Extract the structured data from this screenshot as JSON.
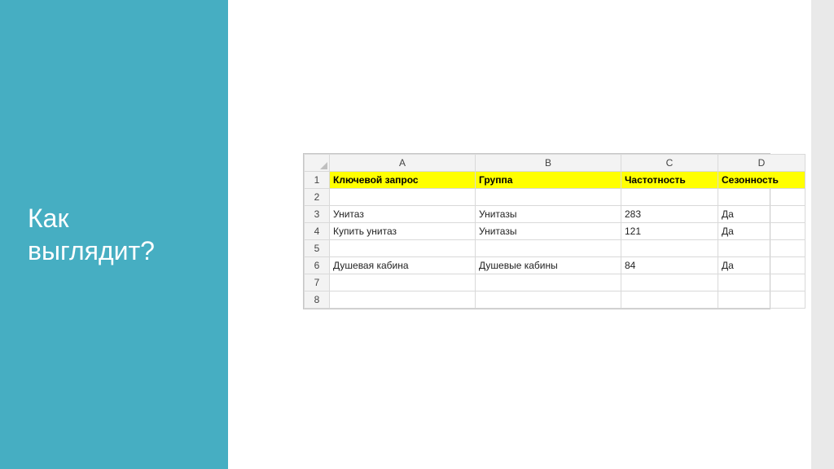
{
  "sidebar": {
    "title_line1": "Как",
    "title_line2": "выглядит?"
  },
  "sheet": {
    "columns": [
      "A",
      "B",
      "C",
      "D"
    ],
    "row_numbers": [
      "1",
      "2",
      "3",
      "4",
      "5",
      "6",
      "7",
      "8"
    ],
    "header_row": {
      "query": "Ключевой запрос",
      "group": "Группа",
      "frequency": "Частотность",
      "seasonality": "Сезонность"
    },
    "rows": {
      "r3": {
        "query": "Унитаз",
        "group": "Унитазы",
        "frequency": "283",
        "seasonality": "Да"
      },
      "r4": {
        "query": "Купить унитаз",
        "group": "Унитазы",
        "frequency": "121",
        "seasonality": "Да"
      },
      "r6": {
        "query": "Душевая кабина",
        "group": "Душевые кабины",
        "frequency": "84",
        "seasonality": "Да"
      }
    }
  }
}
